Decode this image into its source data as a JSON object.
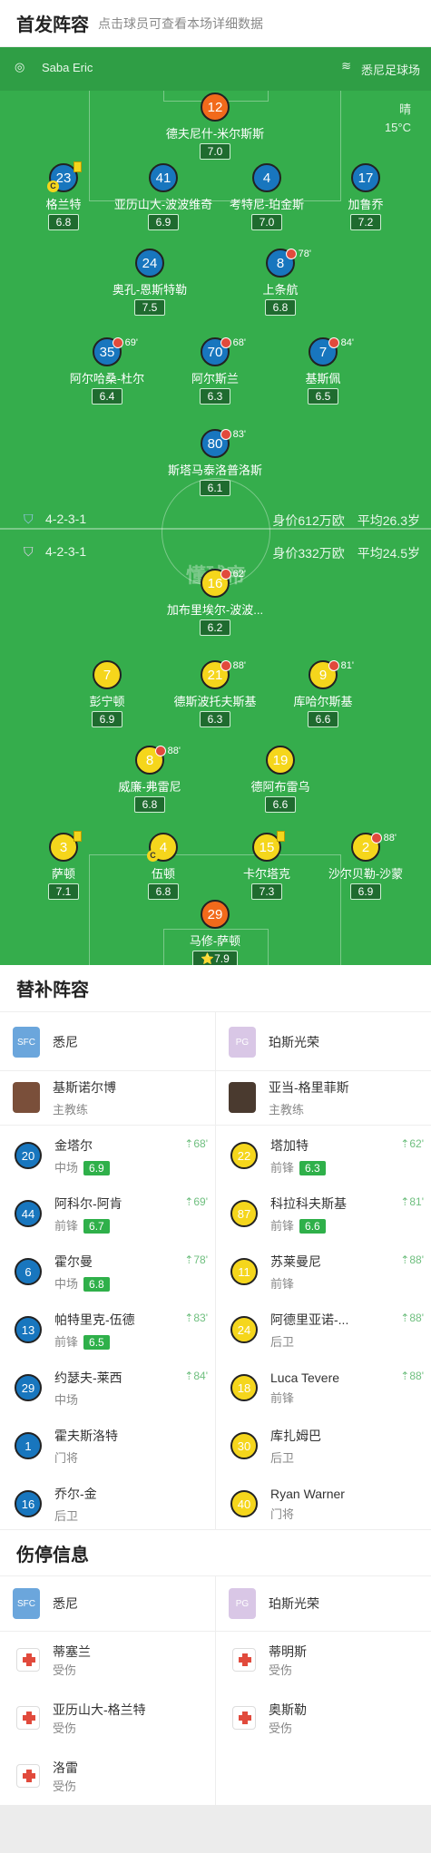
{
  "header": {
    "title": "首发阵容",
    "subtitle": "点击球员可查看本场详细数据"
  },
  "match": {
    "referee": "Saba Eric",
    "venue": "悉尼足球场",
    "weather": "晴",
    "temperature": "15°C"
  },
  "home_team": {
    "name": "悉尼",
    "formation": "4-2-3-1",
    "value": "身价612万欧",
    "avg_age": "平均26.3岁"
  },
  "away_team": {
    "name": "珀斯光荣",
    "formation": "4-2-3-1",
    "value": "身价332万欧",
    "avg_age": "平均24.5岁"
  },
  "watermark": "懂球帝",
  "home_players": [
    {
      "num": "12",
      "name": "德夫尼什-米尔斯斯",
      "rating": "7.0",
      "color": "orange"
    },
    {
      "num": "23",
      "name": "格兰特",
      "rating": "6.8",
      "color": "blue"
    },
    {
      "num": "41",
      "name": "亚历山大-波波维奇",
      "rating": "6.9",
      "color": "blue"
    },
    {
      "num": "4",
      "name": "考特尼-珀金斯",
      "rating": "7.0",
      "color": "blue"
    },
    {
      "num": "17",
      "name": "加鲁乔",
      "rating": "7.2",
      "color": "blue"
    },
    {
      "num": "24",
      "name": "奥孔-恩斯特勒",
      "rating": "7.5",
      "color": "blue"
    },
    {
      "num": "8",
      "name": "上条航",
      "rating": "6.8",
      "color": "blue",
      "sub": "78'"
    },
    {
      "num": "35",
      "name": "阿尔哈桑-杜尔",
      "rating": "6.4",
      "color": "blue",
      "sub": "69'"
    },
    {
      "num": "70",
      "name": "阿尔斯兰",
      "rating": "6.3",
      "color": "blue",
      "sub": "68'"
    },
    {
      "num": "7",
      "name": "基斯佩",
      "rating": "6.5",
      "color": "blue",
      "sub": "84'"
    },
    {
      "num": "80",
      "name": "斯塔马泰洛普洛斯",
      "rating": "6.1",
      "color": "blue",
      "sub": "83'"
    }
  ],
  "away_players": [
    {
      "num": "16",
      "name": "加布里埃尔-波波...",
      "rating": "6.2",
      "color": "yellow",
      "sub": "62'"
    },
    {
      "num": "7",
      "name": "彭宁顿",
      "rating": "6.9",
      "color": "yellow"
    },
    {
      "num": "21",
      "name": "德斯波托夫斯基",
      "rating": "6.3",
      "color": "yellow",
      "sub": "88'"
    },
    {
      "num": "9",
      "name": "库哈尔斯基",
      "rating": "6.6",
      "color": "yellow",
      "sub": "81'"
    },
    {
      "num": "8",
      "name": "威廉-弗雷尼",
      "rating": "6.8",
      "color": "yellow",
      "sub": "88'"
    },
    {
      "num": "19",
      "name": "德阿布雷乌",
      "rating": "6.6",
      "color": "yellow"
    },
    {
      "num": "3",
      "name": "萨顿",
      "rating": "7.1",
      "color": "yellow"
    },
    {
      "num": "4",
      "name": "伍顿",
      "rating": "6.8",
      "color": "yellow"
    },
    {
      "num": "15",
      "name": "卡尔塔克",
      "rating": "7.3",
      "color": "yellow"
    },
    {
      "num": "2",
      "name": "沙尔贝勒-沙蒙",
      "rating": "6.9",
      "color": "yellow",
      "sub": "88'"
    },
    {
      "num": "29",
      "name": "马修-萨顿",
      "rating": "7.9",
      "color": "orange"
    }
  ],
  "subs": {
    "title": "替补阵容",
    "home_team": "悉尼",
    "away_team": "珀斯光荣",
    "home_coach": {
      "name": "基斯诺尔博",
      "role": "主教练"
    },
    "away_coach": {
      "name": "亚当-格里菲斯",
      "role": "主教练"
    },
    "home": [
      {
        "num": "20",
        "name": "金塔尔",
        "pos": "中场",
        "rating": "6.9",
        "time": "68'"
      },
      {
        "num": "44",
        "name": "阿科尔-阿肯",
        "pos": "前锋",
        "rating": "6.7",
        "time": "69'"
      },
      {
        "num": "6",
        "name": "霍尔曼",
        "pos": "中场",
        "rating": "6.8",
        "time": "78'"
      },
      {
        "num": "13",
        "name": "帕特里克-伍德",
        "pos": "前锋",
        "rating": "6.5",
        "time": "83'"
      },
      {
        "num": "29",
        "name": "约瑟夫-莱西",
        "pos": "中场",
        "rating": "",
        "time": "84'"
      },
      {
        "num": "1",
        "name": "霍夫斯洛特",
        "pos": "门将",
        "rating": "",
        "time": ""
      },
      {
        "num": "16",
        "name": "乔尔-金",
        "pos": "后卫",
        "rating": "",
        "time": ""
      }
    ],
    "away": [
      {
        "num": "22",
        "name": "塔加特",
        "pos": "前锋",
        "rating": "6.3",
        "time": "62'"
      },
      {
        "num": "87",
        "name": "科拉科夫斯基",
        "pos": "前锋",
        "rating": "6.6",
        "time": "81'"
      },
      {
        "num": "11",
        "name": "苏莱曼尼",
        "pos": "前锋",
        "rating": "",
        "time": "88'"
      },
      {
        "num": "24",
        "name": "阿德里亚诺-...",
        "pos": "后卫",
        "rating": "",
        "time": "88'"
      },
      {
        "num": "18",
        "name": "Luca Tevere",
        "pos": "前锋",
        "rating": "",
        "time": "88'"
      },
      {
        "num": "30",
        "name": "库扎姆巴",
        "pos": "后卫",
        "rating": "",
        "time": ""
      },
      {
        "num": "40",
        "name": "Ryan Warner",
        "pos": "门将",
        "rating": "",
        "time": ""
      }
    ]
  },
  "injuries": {
    "title": "伤停信息",
    "home_team": "悉尼",
    "away_team": "珀斯光荣",
    "home": [
      {
        "name": "蒂塞兰",
        "status": "受伤"
      },
      {
        "name": "亚历山大-格兰特",
        "status": "受伤"
      },
      {
        "name": "洛雷",
        "status": "受伤"
      }
    ],
    "away": [
      {
        "name": "蒂明斯",
        "status": "受伤"
      },
      {
        "name": "奥斯勒",
        "status": "受伤"
      }
    ]
  }
}
